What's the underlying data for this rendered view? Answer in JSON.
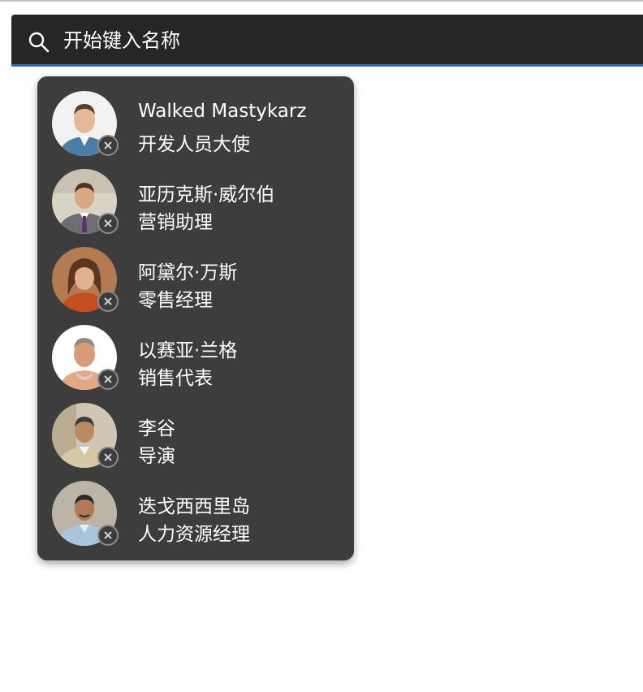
{
  "search": {
    "placeholder": "开始键入名称",
    "icon": "search-icon"
  },
  "colors": {
    "search_background": "#262626",
    "search_underline": "#2a6ab0",
    "panel_background": "#3d3d3d",
    "text": "#ffffff"
  },
  "suggestions": [
    {
      "name": "Walked Mastykarz",
      "title": "开发人员大使"
    },
    {
      "name": "亚历克斯·威尔伯",
      "title": "营销助理"
    },
    {
      "name": "阿黛尔·万斯",
      "title": "零售经理"
    },
    {
      "name": "以赛亚·兰格",
      "title": "销售代表"
    },
    {
      "name": "李谷",
      "title": "导演"
    },
    {
      "name": "迭戈西西里岛",
      "title": "人力资源经理"
    }
  ]
}
